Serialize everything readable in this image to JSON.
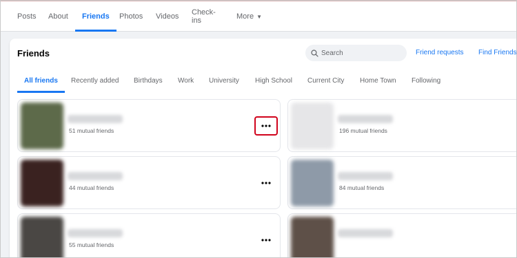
{
  "topnav": {
    "items": [
      {
        "label": "Posts"
      },
      {
        "label": "About"
      },
      {
        "label": "Friends",
        "active": true
      },
      {
        "label": "Photos"
      },
      {
        "label": "Videos"
      },
      {
        "label": "Check-ins"
      },
      {
        "label": "More"
      }
    ]
  },
  "friends_section": {
    "title": "Friends",
    "search": {
      "placeholder": "Search",
      "icon": "search-icon"
    },
    "friend_requests_label": "Friend requests",
    "find_friends_label": "Find Friends",
    "tabs": [
      {
        "label": "All friends",
        "active": true
      },
      {
        "label": "Recently added"
      },
      {
        "label": "Birthdays"
      },
      {
        "label": "Work"
      },
      {
        "label": "University"
      },
      {
        "label": "High School"
      },
      {
        "label": "Current City"
      },
      {
        "label": "Home Town"
      },
      {
        "label": "Following"
      }
    ],
    "friends": [
      {
        "mutual": "51 mutual friends",
        "menu_highlighted": true,
        "avatar_color": "#5d6a4a"
      },
      {
        "mutual": "196 mutual friends",
        "menu_highlighted": false,
        "avatar_color": "#e6e6e8"
      },
      {
        "mutual": "44 mutual friends",
        "menu_highlighted": false,
        "avatar_color": "#3a2220"
      },
      {
        "mutual": "84 mutual friends",
        "menu_highlighted": false,
        "avatar_color": "#8e9aa8"
      },
      {
        "mutual": "55 mutual friends",
        "menu_highlighted": false,
        "avatar_color": "#4a4744"
      },
      {
        "mutual": "",
        "menu_highlighted": false,
        "avatar_color": "#5e5048"
      }
    ]
  },
  "colors": {
    "accent": "#1877f2",
    "highlight_box": "#d0021b",
    "muted_text": "#65676b"
  }
}
